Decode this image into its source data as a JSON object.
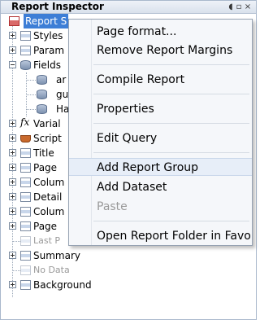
{
  "panel": {
    "title": "Report Inspector",
    "buttons": {
      "pin": "◖",
      "restore": "▫",
      "close": "×"
    }
  },
  "tree": {
    "root": "Report S",
    "items": {
      "styles": "Styles",
      "parameters": "Param",
      "fields": "Fields",
      "field1": "ar",
      "field2": "gu",
      "field3": "Ha",
      "variables": "Varial",
      "scriptlets": "Script",
      "title": "Title",
      "page_header": "Page",
      "column_header": "Colum",
      "detail": "Detail",
      "column_footer": "Colum",
      "page_footer": "Page",
      "last_page_footer": "Last P",
      "summary": "Summary",
      "no_data": "No Data",
      "background": "Background"
    }
  },
  "context_menu": {
    "items": [
      {
        "label": "Page format...",
        "enabled": true
      },
      {
        "label": "Remove Report Margins",
        "enabled": true
      },
      {
        "label": "Compile Report",
        "enabled": true
      },
      {
        "label": "Properties",
        "enabled": true
      },
      {
        "label": "Edit Query",
        "enabled": true
      },
      {
        "label": "Add Report Group",
        "enabled": true,
        "hovered": true
      },
      {
        "label": "Add Dataset",
        "enabled": true
      },
      {
        "label": "Paste",
        "enabled": false
      },
      {
        "label": "Open Report Folder in Favori",
        "enabled": true
      }
    ]
  },
  "colors": {
    "selection": "#3d7ed6",
    "menu_bg": "#f5f7fa",
    "hover": "#e7eef8"
  }
}
